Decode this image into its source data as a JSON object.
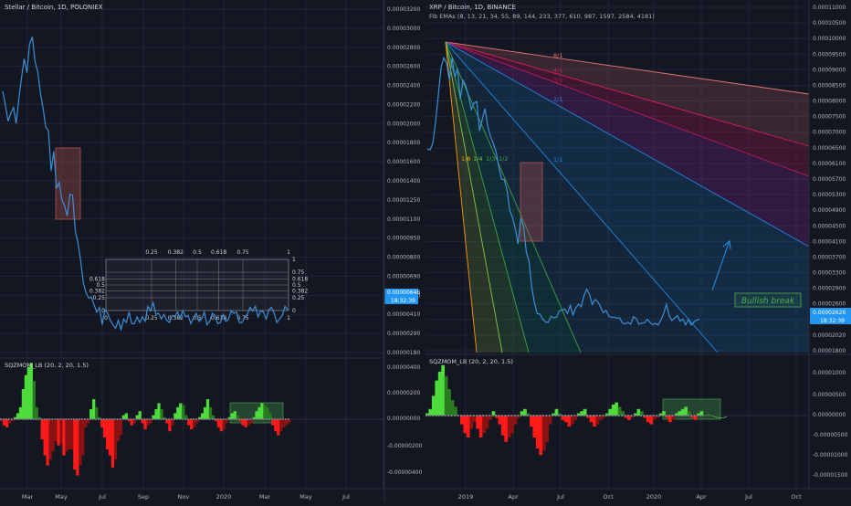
{
  "colors": {
    "bg": "#131722",
    "grid": "#1f2433",
    "price_line": "#3d8fd6",
    "axis_text": "#b2b5be",
    "mom_pos_strong": "#4ddc3c",
    "mom_pos_weak": "#2a7a20",
    "mom_neg_strong": "#ff1a1a",
    "mom_neg_weak": "#8a1212",
    "highlight_red": "#b05050",
    "highlight_green": "#4caf50",
    "price_tag": "#2196f3"
  },
  "chart_data": [
    {
      "type": "line",
      "panel": "left",
      "title": "Stellar / Bitcoin, 1D, POLONIEX",
      "y_ticks": [
        "0.00003200",
        "0.00003000",
        "0.00002800",
        "0.00002600",
        "0.00002400",
        "0.00002200",
        "0.00002000",
        "0.00001800",
        "0.00001600",
        "0.00001400",
        "0.00001250",
        "0.00001100",
        "0.00000950",
        "0.00000800",
        "0.00000690",
        "0.00000530",
        "0.00000410",
        "0.00000290",
        "0.00000180"
      ],
      "x_ticks": [
        "Mar",
        "May",
        "Jul",
        "Sep",
        "Nov",
        "2020",
        "Mar",
        "May",
        "Jul"
      ],
      "last_price": "0.00000646",
      "countdown": "18:32:39",
      "fib_top_labels": [
        "0.25",
        "0.382",
        "0.5",
        "0.618",
        "0.75",
        "1"
      ],
      "fib_bottom_labels": [
        "0",
        "0.25",
        "0.382",
        "0.5",
        "0.618",
        "0.75",
        "1"
      ],
      "fib_right_labels": [
        "1",
        "0.75",
        "0.618",
        "0.5",
        "0.382",
        "0.25",
        "0"
      ],
      "fib_left_labels": [
        "0.618",
        "0.5",
        "0.382",
        "0.25",
        "0"
      ],
      "series": [
        {
          "x": [
            0,
            3,
            6,
            9,
            12,
            15,
            18,
            21,
            24,
            27,
            30,
            33,
            36,
            39,
            42,
            45,
            48,
            51,
            54,
            57,
            60,
            63,
            66,
            69,
            72,
            75,
            78,
            81,
            84,
            87,
            90,
            93,
            96,
            99,
            102,
            105,
            108,
            111,
            114,
            117,
            120,
            123,
            126,
            129,
            132,
            135,
            138,
            141,
            144,
            147,
            150,
            153,
            156,
            159,
            162,
            165,
            168,
            171,
            174,
            177,
            180,
            183,
            186,
            189,
            192,
            195,
            198,
            201,
            204,
            207,
            210,
            213,
            216,
            219,
            222,
            225,
            228,
            231,
            234,
            237,
            240,
            243,
            246,
            249,
            252,
            255,
            258,
            261,
            264,
            267,
            270,
            273,
            276,
            279,
            282,
            285,
            288,
            291,
            294,
            297,
            300,
            303,
            306,
            309,
            312,
            315,
            318
          ],
          "y": [
            24400,
            23200,
            21800,
            22500,
            23000,
            21600,
            23800,
            25600,
            27200,
            26000,
            28500,
            29100,
            27000,
            26100,
            24300,
            22900,
            21300,
            21000,
            17500,
            19200,
            16000,
            16500,
            15000,
            14500,
            13600,
            15500,
            15400,
            12300,
            11300,
            9700,
            7800,
            7000,
            6500,
            6600,
            5900,
            5300,
            5700,
            4200,
            5500,
            5200,
            4600,
            4200,
            3900,
            4600,
            3800,
            4700,
            4400,
            5300,
            4300,
            4300,
            4900,
            4400,
            4900,
            4500,
            5800,
            5400,
            6100,
            5100,
            5200,
            4700,
            5100,
            4600,
            4400,
            5000,
            4900,
            5300,
            4800,
            5400,
            4900,
            5000,
            4300,
            4800,
            5200,
            4500,
            4700,
            5300,
            4200,
            4500,
            5200,
            5000,
            4300,
            4400,
            5100,
            4500,
            4700,
            5400,
            5200,
            5300,
            4400,
            4400,
            4800,
            5100,
            5700,
            5400,
            5800,
            4900,
            5400,
            5300,
            4700,
            5500,
            5700,
            5200,
            4400,
            4700,
            5000,
            5800,
            5500
          ]
        }
      ],
      "momentum": {
        "name": "SQZMOM_LB (20, 2, 20, 1.5)",
        "y_ticks": [
          "0.00000400",
          "0.00000200",
          "0.00000000",
          "-0.00000200",
          "-0.00000400"
        ],
        "values": [
          -10,
          -30,
          -40,
          -20,
          -10,
          10,
          30,
          60,
          150,
          220,
          260,
          280,
          190,
          60,
          10,
          -100,
          -180,
          -230,
          -200,
          -160,
          -110,
          -130,
          -120,
          -180,
          -160,
          -150,
          -150,
          -250,
          -280,
          -230,
          -180,
          -40,
          -20,
          50,
          100,
          60,
          10,
          -40,
          -90,
          -150,
          -180,
          -240,
          -200,
          -110,
          -80,
          20,
          30,
          -10,
          -30,
          -20,
          20,
          40,
          -20,
          -50,
          -30,
          -20,
          20,
          50,
          80,
          50,
          10,
          -20,
          -60,
          -30,
          30,
          60,
          80,
          70,
          20,
          -30,
          -50,
          -40,
          -20,
          10,
          30,
          60,
          100,
          60,
          20,
          -10,
          -40,
          -60,
          -50,
          -20,
          10,
          30,
          40,
          20,
          -10,
          -30,
          -40,
          -30,
          -20,
          10,
          40,
          60,
          80,
          70,
          60,
          30,
          -30,
          -60,
          -80,
          -60,
          -40,
          -30,
          -20
        ]
      }
    },
    {
      "type": "line",
      "panel": "right",
      "title": "XRP / Bitcoin, 1D, BINANCE",
      "subtitle": "Fib EMAs (8, 13, 21, 34, 55, 89, 144, 233, 377, 610, 987, 1597, 2584, 4181)",
      "y_ticks": [
        "0.00011000",
        "0.00010500",
        "0.00010000",
        "0.00009500",
        "0.00009000",
        "0.00008500",
        "0.00008000",
        "0.00007500",
        "0.00007000",
        "0.00006500",
        "0.00006100",
        "0.00005700",
        "0.00005300",
        "0.00004900",
        "0.00004500",
        "0.00004100",
        "0.00003700",
        "0.00003300",
        "0.00002900",
        "0.00002600",
        "0.00002300",
        "0.00002020",
        "0.00001800"
      ],
      "x_ticks": [
        "2019",
        "Apr",
        "Jul",
        "Oct",
        "2020",
        "Apr",
        "Jul",
        "Oct"
      ],
      "last_price": "0.00002626",
      "countdown": "18:32:39",
      "fan_labels": [
        "8/1",
        "4/1",
        "3/1",
        "2/1",
        "1/1",
        "1/2",
        "1/3",
        "1/4",
        "1/8"
      ],
      "annotation": "Bullish break",
      "series": [
        {
          "x": [
            0,
            3,
            6,
            9,
            12,
            15,
            18,
            21,
            24,
            27,
            30,
            33,
            36,
            39,
            42,
            45,
            48,
            51,
            54,
            57,
            60,
            63,
            66,
            69,
            72,
            75,
            78,
            81,
            84,
            87,
            90,
            93,
            96,
            99,
            102,
            105,
            108,
            111,
            114,
            117,
            120,
            123,
            126,
            129,
            132,
            135,
            138,
            141,
            144,
            147,
            150,
            153,
            156,
            159,
            162,
            165,
            168,
            171,
            174,
            177,
            180,
            183,
            186,
            189,
            192,
            195,
            198,
            201,
            204,
            207,
            210,
            213,
            216,
            219,
            222,
            225,
            228,
            231,
            234,
            237,
            240,
            243,
            246,
            249,
            252,
            255,
            258,
            261,
            264,
            267,
            270,
            273,
            276,
            279,
            282,
            285,
            288,
            291,
            294,
            297
          ],
          "y": [
            72000,
            71800,
            73600,
            79200,
            86400,
            94000,
            96500,
            95000,
            90600,
            96500,
            91300,
            93700,
            85400,
            90400,
            89000,
            86100,
            82600,
            84400,
            84700,
            76900,
            80000,
            82900,
            78100,
            75400,
            73600,
            71300,
            67200,
            64000,
            63800,
            61000,
            55600,
            53600,
            50800,
            46600,
            53500,
            51300,
            44400,
            41900,
            34900,
            30800,
            27900,
            27800,
            26500,
            25700,
            25600,
            27200,
            26800,
            27000,
            28700,
            28900,
            29200,
            28000,
            30100,
            27600,
            29400,
            30500,
            29800,
            32800,
            34500,
            33100,
            30400,
            31700,
            31200,
            29800,
            28200,
            28800,
            27300,
            26900,
            27000,
            26700,
            26800,
            25400,
            25200,
            25600,
            25100,
            27100,
            26600,
            25100,
            25400,
            25500,
            26400,
            25600,
            25000,
            25300,
            24900,
            26300,
            28000,
            30400,
            27400,
            26100,
            26800,
            27400,
            25900,
            26500,
            24900,
            26400,
            24900,
            25700,
            26200,
            26500
          ]
        }
      ],
      "momentum": {
        "name": "SQZMOM_LB (20, 2, 20, 1.5)",
        "y_ticks": [
          "0.00001000",
          "0.00000500",
          "0.00000000",
          "-0.00000500",
          "-0.00001000",
          "-0.00001500"
        ],
        "values": [
          10,
          30,
          90,
          160,
          200,
          230,
          180,
          120,
          70,
          40,
          0,
          -40,
          -80,
          -100,
          -60,
          -30,
          -60,
          -100,
          -80,
          -60,
          -20,
          20,
          -10,
          -40,
          -90,
          -120,
          -100,
          -80,
          -40,
          -10,
          20,
          30,
          10,
          -50,
          -100,
          -150,
          -180,
          -160,
          -120,
          -40,
          10,
          30,
          10,
          -20,
          -30,
          -50,
          -40,
          -20,
          10,
          20,
          30,
          -10,
          -30,
          -50,
          -40,
          -20,
          -10,
          10,
          30,
          50,
          60,
          40,
          20,
          -10,
          -20,
          -10,
          10,
          30,
          20,
          -10,
          -30,
          -40,
          -20,
          -10,
          10,
          20,
          -10,
          -30,
          -20,
          10,
          20,
          30,
          40,
          20,
          -10,
          -20,
          10,
          20
        ]
      }
    }
  ]
}
